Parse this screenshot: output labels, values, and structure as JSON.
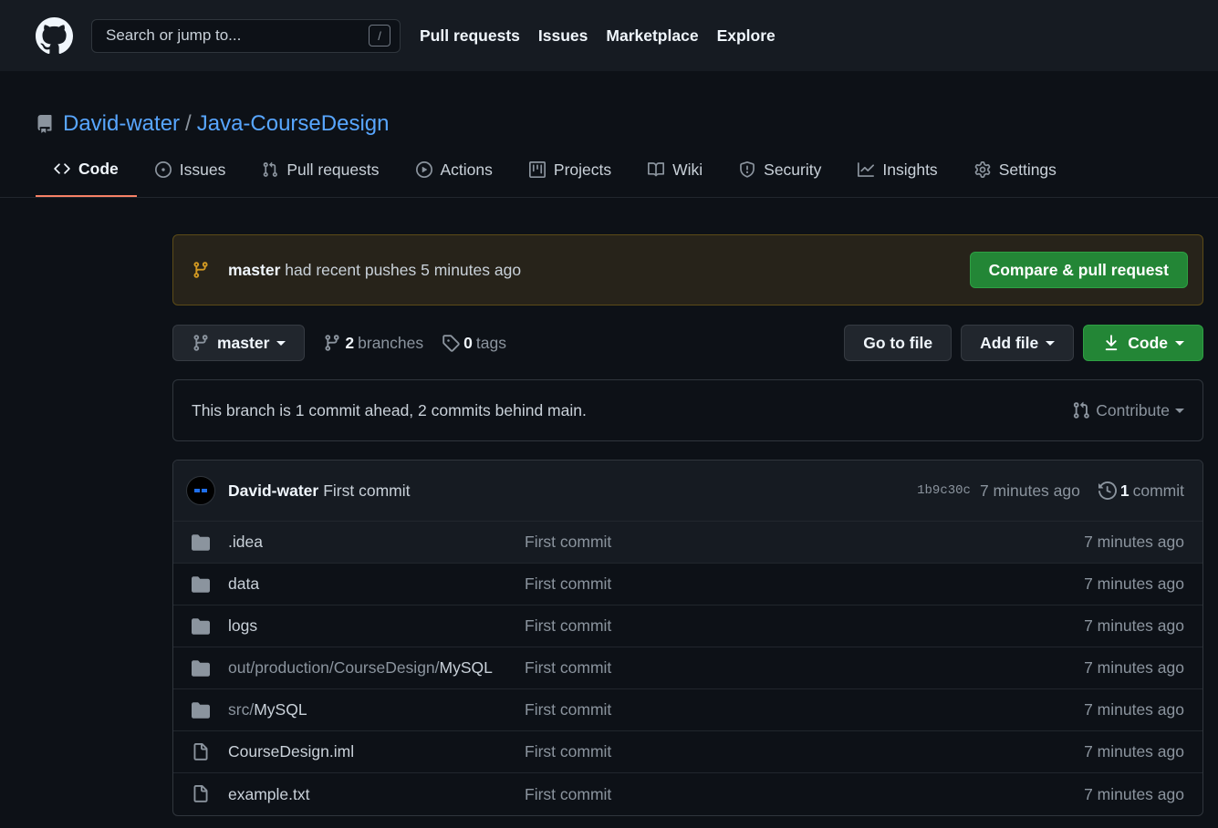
{
  "header": {
    "search_placeholder": "Search or jump to...",
    "slash_key": "/",
    "nav": [
      "Pull requests",
      "Issues",
      "Marketplace",
      "Explore"
    ]
  },
  "repo": {
    "owner": "David-water",
    "separator": "/",
    "name": "Java-CourseDesign"
  },
  "tabs": [
    {
      "label": "Code",
      "icon": "code-icon"
    },
    {
      "label": "Issues",
      "icon": "issue-opened-icon"
    },
    {
      "label": "Pull requests",
      "icon": "git-pull-request-icon"
    },
    {
      "label": "Actions",
      "icon": "play-icon"
    },
    {
      "label": "Projects",
      "icon": "project-icon"
    },
    {
      "label": "Wiki",
      "icon": "book-icon"
    },
    {
      "label": "Security",
      "icon": "shield-icon"
    },
    {
      "label": "Insights",
      "icon": "graph-icon"
    },
    {
      "label": "Settings",
      "icon": "gear-icon"
    }
  ],
  "push_banner": {
    "branch": "master",
    "text": "had recent pushes 5 minutes ago",
    "button": "Compare & pull request"
  },
  "branchbar": {
    "branch": "master",
    "branches_count": "2",
    "branches_label": "branches",
    "tags_count": "0",
    "tags_label": "tags",
    "goto_file": "Go to file",
    "add_file": "Add file",
    "code": "Code"
  },
  "ahead": {
    "text": "This branch is 1 commit ahead, 2 commits behind main.",
    "contribute": "Contribute"
  },
  "latest_commit": {
    "author": "David-water",
    "message": "First commit",
    "sha": "1b9c30c",
    "time": "7 minutes ago",
    "count": "1",
    "count_label": "commit"
  },
  "files": [
    {
      "type": "dir",
      "prefix": "",
      "name": ".idea",
      "message": "First commit",
      "time": "7 minutes ago"
    },
    {
      "type": "dir",
      "prefix": "",
      "name": "data",
      "message": "First commit",
      "time": "7 minutes ago"
    },
    {
      "type": "dir",
      "prefix": "",
      "name": "logs",
      "message": "First commit",
      "time": "7 minutes ago"
    },
    {
      "type": "dir",
      "prefix": "out/production/CourseDesign/",
      "name": "MySQL",
      "message": "First commit",
      "time": "7 minutes ago"
    },
    {
      "type": "dir",
      "prefix": "src/",
      "name": "MySQL",
      "message": "First commit",
      "time": "7 minutes ago"
    },
    {
      "type": "file",
      "prefix": "",
      "name": "CourseDesign.iml",
      "message": "First commit",
      "time": "7 minutes ago"
    },
    {
      "type": "file",
      "prefix": "",
      "name": "example.txt",
      "message": "First commit",
      "time": "7 minutes ago"
    }
  ],
  "colors": {
    "bg": "#0d1117",
    "header_bg": "#161b22",
    "link": "#58a6ff",
    "green": "#238636",
    "tab_underline": "#f78166",
    "banner_bg": "#27231a",
    "banner_icon": "#d29922"
  }
}
